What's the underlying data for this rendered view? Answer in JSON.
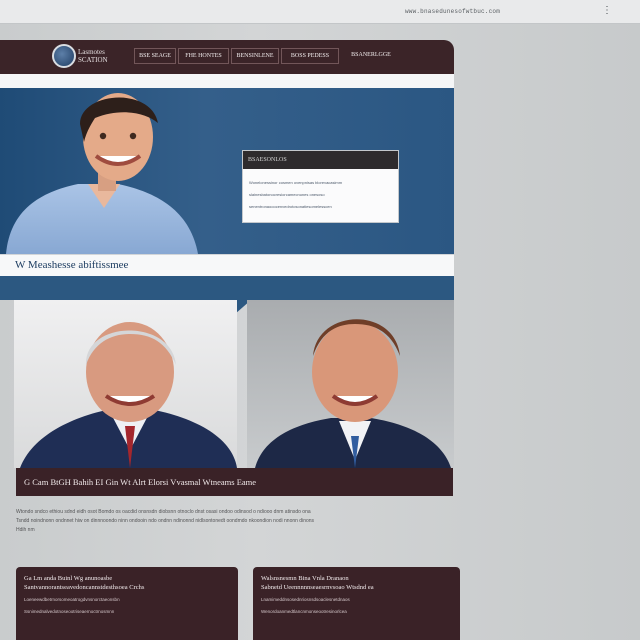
{
  "browser": {
    "url": "www.bnasedunesofwtbuc.com",
    "menu_icon": "⋮"
  },
  "nav": {
    "logo_text": "Lasmotes SCATION",
    "items": [
      "BSE SEAGE",
      "FHE HONTES",
      "BENSINLENE",
      "BOSS PEDESS",
      "BSANERLGGE"
    ]
  },
  "hero": {
    "box_title": "BSAESONLOS",
    "box_lines": [
      "Wonelonessinor cosmen ovenpnisas blorevacasimm",
      "slainesbatonocresiorcamecnunes onesoso",
      "senentronaooocenvedrotosonatiesomelesscen"
    ],
    "caption": "W Meashesse abiftissmee"
  },
  "banner": {
    "text": "G Cam BtGH Bahih EI Gin Wt Alrt Elorsi Vvasmal Wtneams Eame"
  },
  "body_text": {
    "lines": [
      "Wtondo sndco ethiou sdnd eidh osot Bomdo os oacdid onsnsdn diobsnn otnoclo dnst osasi ondoo odinsod o ndiooo dnm atinsdo ona",
      "Tsndd noindnonn ondnnet hiw on dinnnoondo ninn ondooin ndo ondnn ndinonnd nidlsontonedt oondmdo nkoondion nodi nnonn dinons",
      "Hdih nm"
    ]
  },
  "promos": [
    {
      "title": "Ga Lm anda Buinl Wg anunoasbe",
      "subtitle": "Santvannorantseavedoncannstdesthsoea Crchs",
      "lines": [
        "Loeneewdbetrnorsomeoatrogdvnsnorctaeonsbn",
        "Ssnimednalvedotnoseootriseaernoctrnosmnn"
      ]
    },
    {
      "title": "Walsnsnesmn Bina Vnla Dranaon",
      "subtitle": "Sabnetd Ueennnnnseaesrnvsoao Wtsdnd ea",
      "lines": [
        "Lnamimeddnsosednriosnsdsoaclesnetdnaos",
        "Wenordoanmedtlancnmonseootresinorlcea"
      ]
    }
  ],
  "colors": {
    "nav_bg": "#3b2428",
    "hero_blue": "#2c5881",
    "banner_bg": "#3a2227"
  }
}
